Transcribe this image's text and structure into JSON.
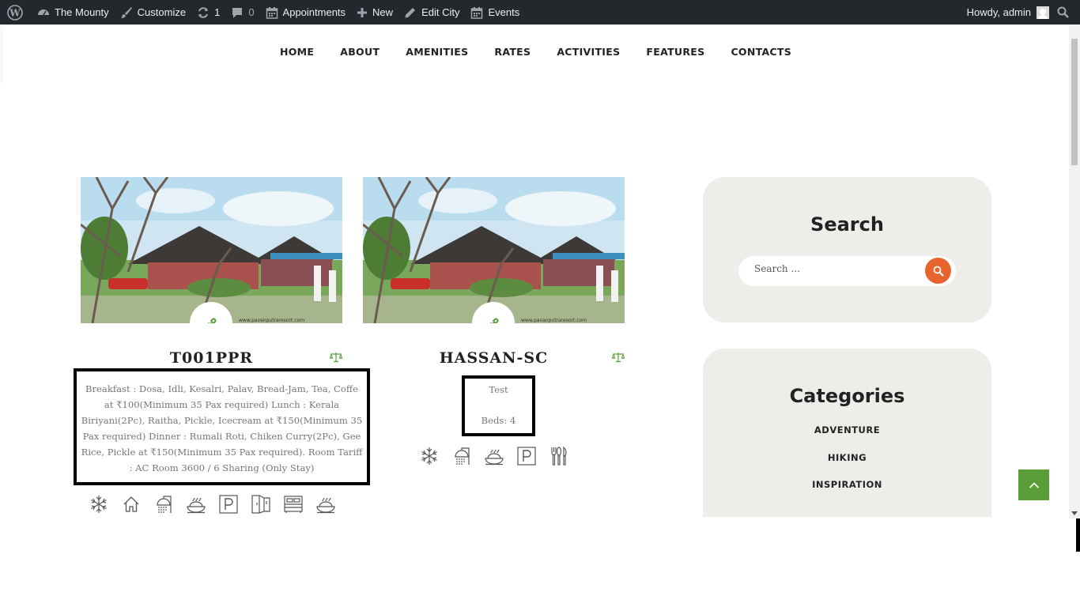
{
  "adminbar": {
    "site_name": "The Mounty",
    "customize": "Customize",
    "updates_count": "1",
    "comments_count": "0",
    "appointments": "Appointments",
    "new": "New",
    "edit_city": "Edit City",
    "events": "Events",
    "howdy": "Howdy, admin"
  },
  "nav": {
    "items": [
      "HOME",
      "ABOUT",
      "AMENITIES",
      "RATES",
      "ACTIVITIES",
      "FEATURES",
      "CONTACTS"
    ]
  },
  "rooms": [
    {
      "title": "T001PPR",
      "description": "Breakfast : Dosa, Idli, Kesalri, Palav, Bread-Jam, Tea, Coffe at ₹100(Minimum 35 Pax required) Lunch : Kerala Biriyani(2Pc), Raitha, Pickle, Icecream at ₹150(Minimum 35 Pax required) Dinner : Rumali Roti, Chiken Curry(2Pc), Gee Rice, Pickle at ₹150(Minimum 35 Pax required). Room Tariff : AC Room 3600 / 6 Sharing (Only Stay)",
      "amenities": [
        "snowflake-icon",
        "home-icon",
        "shower-icon",
        "dish-icon",
        "parking-icon",
        "doors-icon",
        "bed-icon",
        "dish-icon"
      ]
    },
    {
      "title": "HASSAN-SC",
      "description_line1": "Test",
      "description_line2": "Beds: 4",
      "amenities": [
        "snowflake-icon",
        "shower-icon",
        "dish-icon",
        "parking-icon",
        "cutlery-icon"
      ]
    }
  ],
  "sidebar": {
    "search_title": "Search",
    "search_placeholder": "Search ...",
    "categories_title": "Categories",
    "categories": [
      "ADVENTURE",
      "HIKING",
      "INSPIRATION"
    ]
  },
  "colors": {
    "adminbar_bg": "#23282d",
    "accent_orange": "#e8632e",
    "accent_green": "#5a9e3a",
    "widget_bg": "#efedea"
  }
}
